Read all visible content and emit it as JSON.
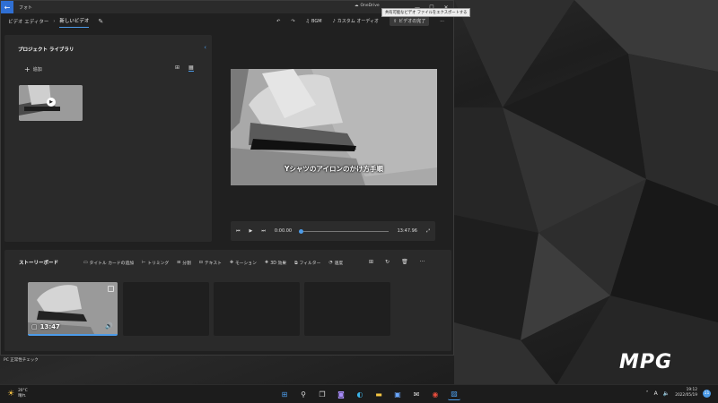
{
  "window": {
    "app_name": "フォト",
    "onedrive": "OneDrive",
    "tooltip": "共有可能なビデオ ファイルをエクスポートする",
    "minimize": "—",
    "maximize": "☐",
    "close": "✕"
  },
  "nav": {
    "breadcrumb_root": "ビデオ エディター",
    "breadcrumb_sep": "›",
    "breadcrumb_current": "新しいビデオ",
    "toolbar": {
      "bgm": "BGM",
      "custom_audio": "カスタム オーディオ",
      "finish": "ビデオの完了"
    }
  },
  "library": {
    "title": "プロジェクト ライブラリ",
    "add": "追加"
  },
  "preview": {
    "caption": "Yシャツのアイロンのかけ方手順"
  },
  "player": {
    "current_time": "0:00.00",
    "total_time": "13:47.96",
    "progress": 0.0
  },
  "storyboard": {
    "title": "ストーリーボード",
    "tools": {
      "title_card": "タイトル カードの追加",
      "trim": "トリミング",
      "split": "分割",
      "text": "テキスト",
      "motion": "モーション",
      "effects_3d": "3D 効果",
      "filter": "フィルター",
      "speed": "速度"
    },
    "clip_duration": "13:47"
  },
  "desktop": {
    "pc_text": "PC 正常性チェック",
    "brand": "MPG"
  },
  "taskbar": {
    "temperature": "20°C",
    "weather": "晴れ",
    "ime": "A",
    "time": "19:12",
    "date": "2022/05/19",
    "notifications": "11"
  },
  "icons": [
    "back-arrow-icon",
    "undo-icon",
    "redo-icon",
    "music-icon",
    "play-icon",
    "search-icon",
    "edge-icon",
    "chrome-icon"
  ],
  "colors": {
    "accent": "#4c9be8",
    "back_button": "#2f6fd3",
    "window_bg": "#202020",
    "panel_bg": "#2a2a2a"
  }
}
